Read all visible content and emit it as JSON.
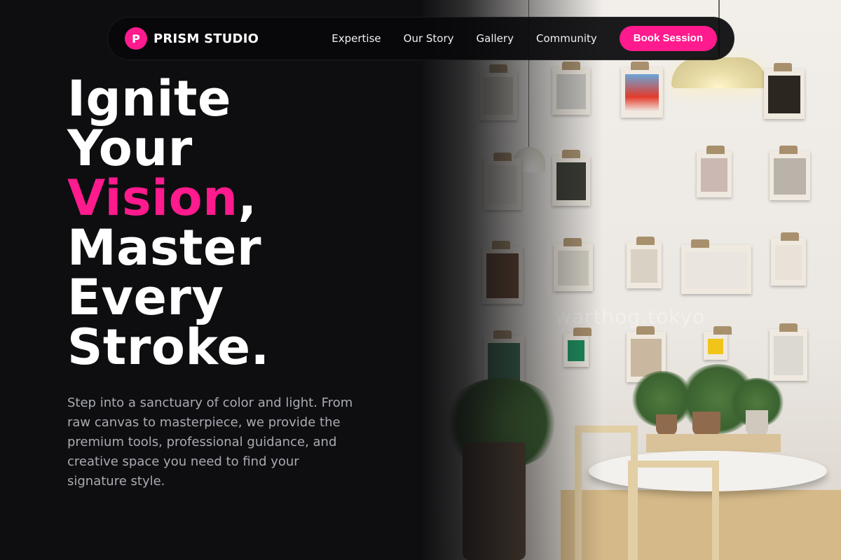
{
  "brand": {
    "logo_letter": "P",
    "name": "PRISM STUDIO"
  },
  "nav": {
    "links": [
      "Expertise",
      "Our Story",
      "Gallery",
      "Community"
    ],
    "cta_label": "Book Session"
  },
  "hero": {
    "line1": "Ignite",
    "line2": "Your",
    "line3_accent": "Vision",
    "line3_punct": ",",
    "line4": "Master",
    "line5": "Every",
    "line6": "Stroke.",
    "subtext": "Step into a sanctuary of color and light. From raw canvas to masterpiece, we provide the premium tools, professional guidance, and creative space you need to find your signature style."
  },
  "photo": {
    "watermark": "warthog.tokyo"
  },
  "colors": {
    "accent": "#ff1b8d",
    "background": "#0e0e10",
    "subtext": "#a9abb3"
  }
}
